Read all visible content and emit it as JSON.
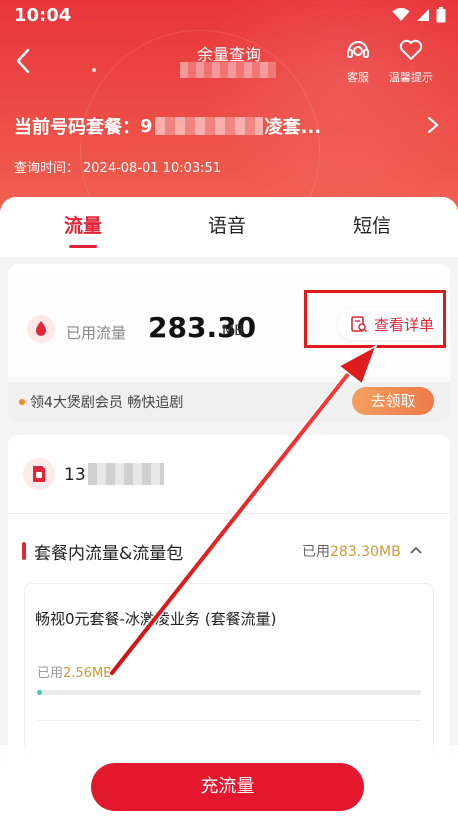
{
  "status_bar": {
    "time": "10:04"
  },
  "nav": {
    "title": "余量查询",
    "service_label": "客服",
    "tips_label": "温馨提示"
  },
  "plan": {
    "label": "当前号码套餐：",
    "prefix": "9",
    "suffix": "凌套..."
  },
  "query": {
    "label": "查询时间：",
    "value": "2024-08-01 10:03:51"
  },
  "tabs": [
    {
      "label": "流量",
      "active": true
    },
    {
      "label": "语音",
      "active": false
    },
    {
      "label": "短信",
      "active": false
    }
  ],
  "usage": {
    "label": "已用流量",
    "value": "283.30",
    "unit": "MB",
    "detail_button": "查看详单"
  },
  "promo": {
    "text": "领4大煲剧会员 畅快追剧",
    "button": "去领取",
    "dot_color": "#f08a24"
  },
  "account": {
    "number_prefix": "13"
  },
  "package_section": {
    "title": "套餐内流量&流量包",
    "used_label": "已用",
    "used_value": "283.30MB"
  },
  "package_item": {
    "name": "畅视0元套餐-冰激凌业务 (套餐流量)",
    "used_label": "已用",
    "used_value": "2.56MB",
    "progress_fraction": 0.01
  },
  "charge_button": "充流量",
  "colors": {
    "accent": "#e1263a",
    "header": "#e8353a",
    "progress": "#3ccbb4",
    "gold": "#c99a3b"
  }
}
